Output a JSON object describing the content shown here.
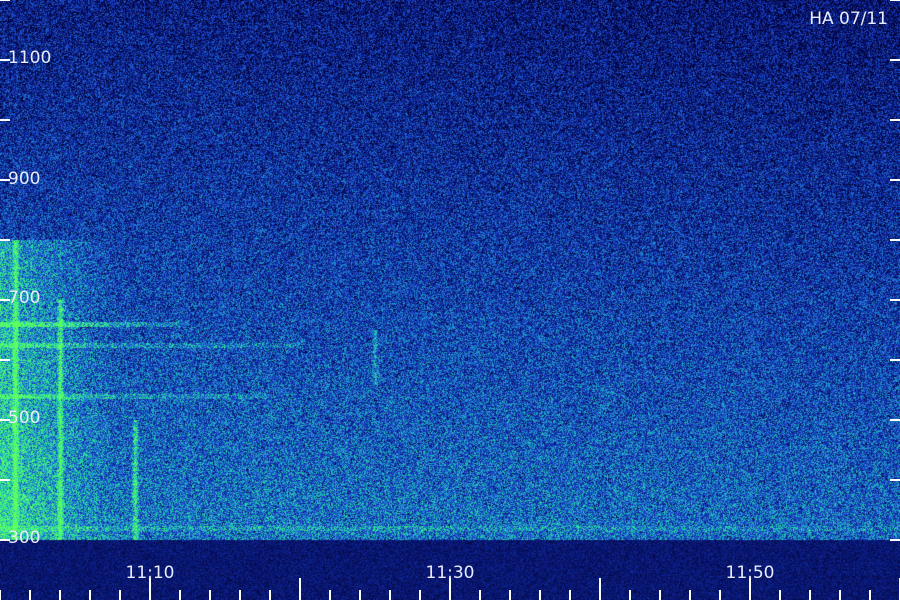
{
  "chart_data": {
    "type": "heatmap",
    "title": "HA 07/11",
    "xlabel": "",
    "ylabel": "",
    "x_tick_labels": [
      "11:10",
      "11:30",
      "11:50"
    ],
    "x_major_ticks": [
      "11:10",
      "11:20",
      "11:30",
      "11:40",
      "11:50",
      "12:00"
    ],
    "x_minor_interval_min": 2,
    "x_range": [
      "11:00",
      "12:00"
    ],
    "y_tick_labels": [
      "1100",
      "900",
      "700",
      "500",
      "300"
    ],
    "y_ticks": [
      300,
      400,
      500,
      600,
      700,
      800,
      900,
      1000,
      1100,
      1200
    ],
    "y_range": [
      300,
      1200
    ],
    "grid": false,
    "colormap": [
      "#000030",
      "#0a1a7a",
      "#1a3cc8",
      "#1e8cd0",
      "#27e0a0",
      "#60ff60"
    ],
    "features": [
      {
        "kind": "diffuse emission",
        "start": "11:00",
        "end": "11:05",
        "freq_low": 300,
        "freq_high": 800,
        "intensity": "high"
      },
      {
        "kind": "horizontal band",
        "freq": 660,
        "start": "11:00",
        "end": "11:12",
        "intensity": "high"
      },
      {
        "kind": "horizontal band",
        "freq": 625,
        "start": "11:00",
        "end": "11:20",
        "intensity": "medium"
      },
      {
        "kind": "horizontal band",
        "freq": 540,
        "start": "11:00",
        "end": "11:18",
        "intensity": "medium"
      },
      {
        "kind": "vertical burst",
        "time": "11:01",
        "freq_low": 300,
        "freq_high": 800,
        "intensity": "high"
      },
      {
        "kind": "vertical burst",
        "time": "11:04",
        "freq_low": 300,
        "freq_high": 700,
        "intensity": "high"
      },
      {
        "kind": "vertical burst",
        "time": "11:09",
        "freq_low": 300,
        "freq_high": 500,
        "intensity": "high"
      },
      {
        "kind": "vertical burst",
        "time": "11:25",
        "freq_low": 560,
        "freq_high": 650,
        "intensity": "medium"
      },
      {
        "kind": "horizontal band",
        "freq": 320,
        "start": "11:00",
        "end": "12:00",
        "intensity": "low"
      }
    ]
  }
}
